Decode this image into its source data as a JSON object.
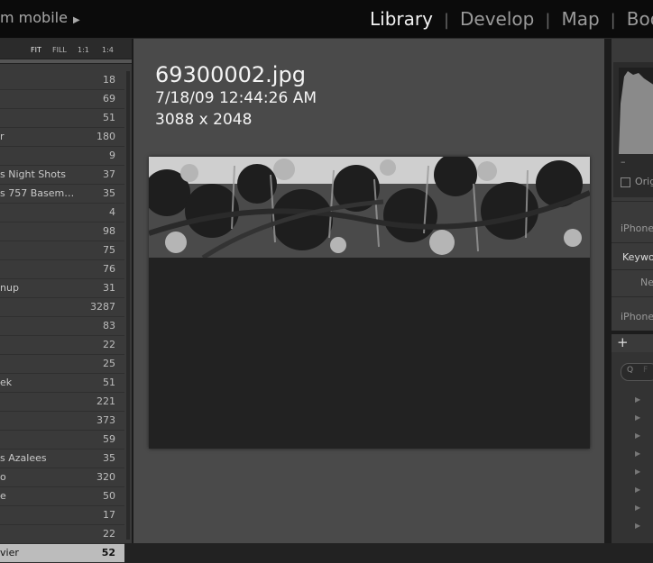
{
  "topbar": {
    "brand": "m mobile",
    "brand_arrow": "▶",
    "modules": [
      "Library",
      "Develop",
      "Map",
      "Boo"
    ],
    "active_module": "Library"
  },
  "navigator": {
    "options": [
      "FIT",
      "FILL",
      "1:1",
      "1:4"
    ]
  },
  "folders": [
    {
      "name": "",
      "count": "18"
    },
    {
      "name": "",
      "count": "69"
    },
    {
      "name": "",
      "count": "51"
    },
    {
      "name": "r",
      "count": "180"
    },
    {
      "name": "",
      "count": "9"
    },
    {
      "name": "s Night Shots",
      "count": "37"
    },
    {
      "name": "s 757 Basem…",
      "count": "35"
    },
    {
      "name": "",
      "count": "4"
    },
    {
      "name": "",
      "count": "98"
    },
    {
      "name": "",
      "count": "75"
    },
    {
      "name": "",
      "count": "76"
    },
    {
      "name": "nup",
      "count": "31"
    },
    {
      "name": "",
      "count": "3287"
    },
    {
      "name": "",
      "count": "83"
    },
    {
      "name": "",
      "count": "22"
    },
    {
      "name": "",
      "count": "25"
    },
    {
      "name": "ek",
      "count": "51"
    },
    {
      "name": "",
      "count": "221"
    },
    {
      "name": "",
      "count": "373"
    },
    {
      "name": "",
      "count": "59"
    },
    {
      "name": "s Azalees",
      "count": "35"
    },
    {
      "name": "o",
      "count": "320"
    },
    {
      "name": "e",
      "count": "50"
    },
    {
      "name": "",
      "count": "17"
    },
    {
      "name": "",
      "count": "22"
    },
    {
      "name": "vier",
      "count": "52",
      "selected": true
    }
  ],
  "photo": {
    "filename": "69300002.jpg",
    "datetime": "7/18/09 12:44:26 AM",
    "dimensions": "3088 x 2048"
  },
  "right_panel": {
    "histogram_dash": "–",
    "original_label": "Origi",
    "iphone_1": "iPhone",
    "keyword_label": "Keywo",
    "new_label": "Ne",
    "iphone_2": "iPhone",
    "plus": "+",
    "search_glyph": "Q",
    "search_hint": "F"
  }
}
